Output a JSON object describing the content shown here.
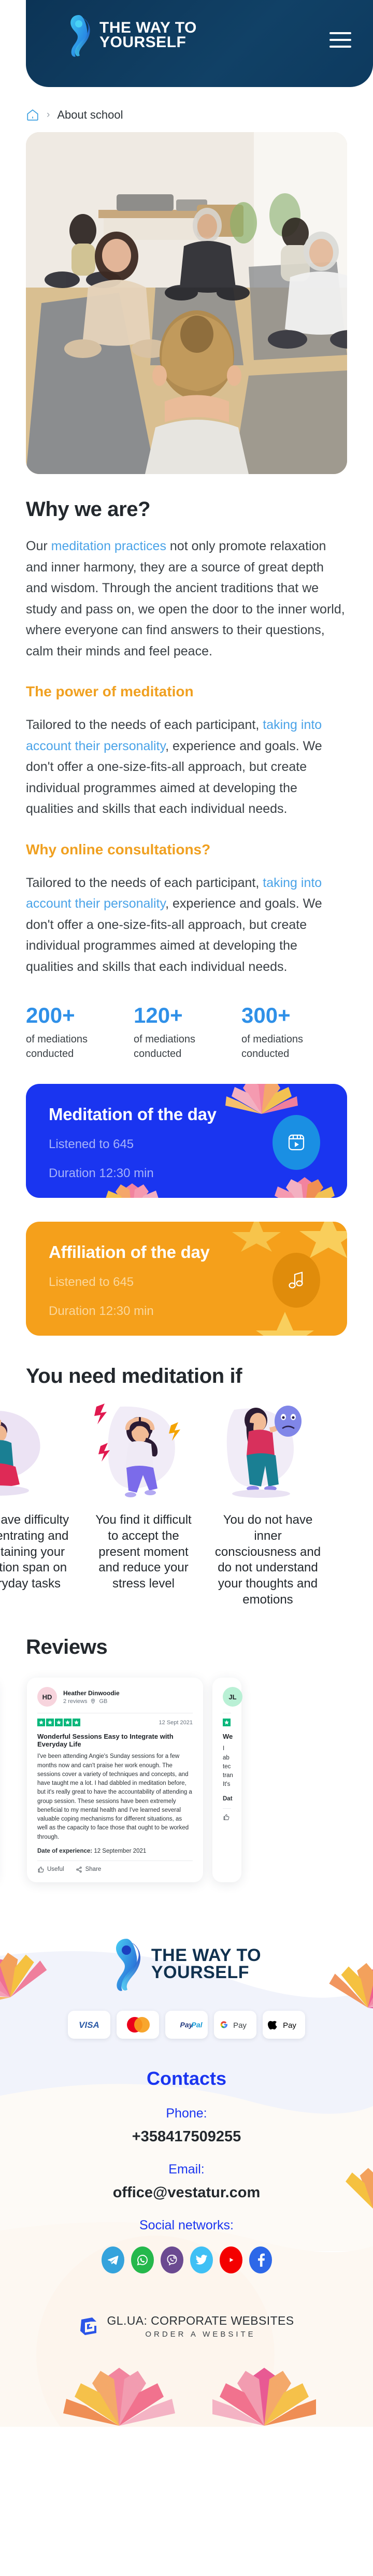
{
  "header": {
    "logo_line1": "THE WAY TO",
    "logo_line2": "YOURSELF",
    "menu_icon": "hamburger-menu-icon"
  },
  "breadcrumb": {
    "home_icon": "home-icon",
    "separator": "›",
    "current": "About school"
  },
  "hero": {
    "alt": "group-meditation-class-photo"
  },
  "why": {
    "title": "Why we are?",
    "paragraph_pre": "Our ",
    "paragraph_link": "meditation practices",
    "paragraph_post": " not only promote relaxation and inner harmony, they are a source of great depth and wisdom. Through the ancient traditions that we study and pass on, we open the door to the inner world, where everyone can find answers to their questions, calm their minds and feel peace."
  },
  "power": {
    "title": "The power of meditation",
    "pre": "Tailored to the needs of each participant, ",
    "link": "taking into account their personality",
    "post": ", experience and goals. We don't offer a one-size-fits-all approach, but create individual programmes aimed at developing the qualities and skills that each individual needs."
  },
  "online": {
    "title": "Why online consultations?",
    "pre": "Tailored to the needs of each participant, ",
    "link": "taking into account their personality",
    "post": ", experience and goals. We don't offer a one-size-fits-all approach, but create individual programmes aimed at developing the qualities and skills that each individual needs."
  },
  "stats": [
    {
      "number": "200+",
      "caption": "of mediations conducted"
    },
    {
      "number": "120+",
      "caption": "of mediations conducted"
    },
    {
      "number": "300+",
      "caption": "of mediations conducted"
    }
  ],
  "promos": [
    {
      "title": "Meditation of the day",
      "listened": "Listened to 645",
      "duration": "Duration 12:30 min",
      "icon": "video-play-icon",
      "color": "#1a35f0"
    },
    {
      "title": "Affiliation of the day",
      "listened": "Listened to 645",
      "duration": "Duration 12:30 min",
      "icon": "music-note-icon",
      "color": "#f5a01b"
    }
  ],
  "need": {
    "title": "You need meditation if",
    "cards": [
      {
        "art": "man-sitting-thinking-illustration",
        "text": "You have difficulty concentrating and maintaining your attention span on everyday tasks"
      },
      {
        "art": "stressed-woman-illustration",
        "text": "You find it difficult to accept the present moment and reduce your stress level"
      },
      {
        "art": "woman-holding-mask-illustration",
        "text": "You do not have inner consciousness and do not understand your thoughts and emotions"
      }
    ]
  },
  "reviews": {
    "title": "Reviews",
    "main": {
      "initials": "HD",
      "avatar_color": "#f7d4dd",
      "name": "Heather Dinwoodie",
      "count": "2 reviews",
      "location_icon": "location-pin-icon",
      "location": "GB",
      "stars": 5,
      "star_color": "#00b67a",
      "date": "12 Sept 2021",
      "title": "Wonderful Sessions Easy to Integrate with Everyday Life",
      "body": "I've been attending Angie's Sunday sessions for a few months now and can't praise her work enough. The sessions cover a variety of techniques and concepts, and have taught me a lot. I had dabbled in meditation before, but it's really great to have the accountability of attending a group session. These sessions have been extremely beneficial to my mental health and I've learned several valuable coping mechanisms for different situations, as well as the capacity to face those that ought to be worked through.",
      "experience_label": "Date of experience:",
      "experience_date": "12 September 2021",
      "useful_label": "Useful",
      "useful_icon": "thumbs-up-icon",
      "share_label": "Share",
      "share_icon": "share-icon"
    },
    "peek_right": {
      "initials": "JL",
      "avatar_color": "#b9f0d5",
      "title_fragment": "We",
      "body_fragments": [
        "I ab",
        "tec",
        "tran",
        "It's"
      ],
      "experience_fragment": "Dat"
    },
    "peek_left": {
      "date_fragment": "021",
      "body_fragment": "e"
    }
  },
  "footer": {
    "logo_line1": "THE WAY TO",
    "logo_line2": "YOURSELF",
    "payments": [
      "VISA",
      "Mastercard",
      "PayPal",
      "G Pay",
      "Apple Pay"
    ],
    "contacts_title": "Contacts",
    "phone_label": "Phone:",
    "phone_value": "+358417509255",
    "email_label": "Email:",
    "email_value": "office@vestatur.com",
    "social_label": "Social networks:",
    "socials": [
      {
        "name": "telegram-icon",
        "color": "#35a3dc"
      },
      {
        "name": "whatsapp-icon",
        "color": "#25b84c"
      },
      {
        "name": "viber-icon",
        "color": "#6b4a91"
      },
      {
        "name": "twitter-icon",
        "color": "#3fc0f5"
      },
      {
        "name": "youtube-icon",
        "color": "#f40000"
      },
      {
        "name": "facebook-icon",
        "color": "#2d68e8"
      }
    ],
    "glua_icon": "glua-logo-icon",
    "glua_line1": "GL.UA: CORPORATE WEBSITES",
    "glua_line2": "ORDER A WEBSITE"
  },
  "colors": {
    "brand_dark": "#0d3a5f",
    "accent_blue": "#2f90e8",
    "accent_orange": "#f0a020",
    "promo_blue": "#1a35f0",
    "promo_orange": "#f5a01b",
    "link_blue": "#4aa3e8"
  }
}
